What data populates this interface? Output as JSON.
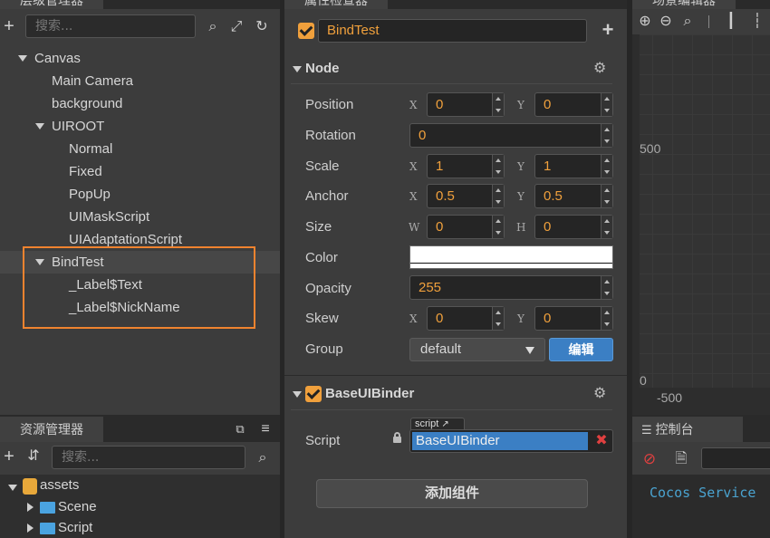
{
  "hierarchy": {
    "title": "层级管理器",
    "search_placeholder": "搜索...",
    "nodes": [
      {
        "label": "Canvas"
      },
      {
        "label": "Main Camera"
      },
      {
        "label": "background"
      },
      {
        "label": "UIROOT"
      },
      {
        "label": "Normal"
      },
      {
        "label": "Fixed"
      },
      {
        "label": "PopUp"
      },
      {
        "label": "UIMaskScript"
      },
      {
        "label": "UIAdaptationScript"
      },
      {
        "label": "BindTest"
      },
      {
        "label": "_Label$Text"
      },
      {
        "label": "_Label$NickName"
      }
    ],
    "highlight_color": "#f0832f"
  },
  "assets": {
    "title": "资源管理器",
    "search_placeholder": "搜索...",
    "items": [
      {
        "label": "assets"
      },
      {
        "label": "Scene"
      },
      {
        "label": "Script"
      }
    ]
  },
  "inspector": {
    "title": "属性检查器",
    "node_name": "BindTest",
    "node_section": "Node",
    "props": {
      "position": {
        "label": "Position",
        "x_axis": "X",
        "y_axis": "Y",
        "x": "0",
        "y": "0"
      },
      "rotation": {
        "label": "Rotation",
        "value": "0"
      },
      "scale": {
        "label": "Scale",
        "x_axis": "X",
        "y_axis": "Y",
        "x": "1",
        "y": "1"
      },
      "anchor": {
        "label": "Anchor",
        "x_axis": "X",
        "y_axis": "Y",
        "x": "0.5",
        "y": "0.5"
      },
      "size": {
        "label": "Size",
        "w_axis": "W",
        "h_axis": "H",
        "w": "0",
        "h": "0"
      },
      "color": {
        "label": "Color",
        "value": "#ffffff"
      },
      "opacity": {
        "label": "Opacity",
        "value": "255"
      },
      "skew": {
        "label": "Skew",
        "x_axis": "X",
        "y_axis": "Y",
        "x": "0",
        "y": "0"
      },
      "group": {
        "label": "Group",
        "value": "default",
        "edit_label": "编辑"
      }
    },
    "component": {
      "name": "BaseUIBinder",
      "script_label": "Script",
      "script_tag": "script",
      "script_value": "BaseUIBinder"
    },
    "add_component_label": "添加组件"
  },
  "scene": {
    "title": "场景编辑器",
    "ruler_labels": {
      "y500": "500",
      "y0": "0",
      "x_neg500": "-500"
    }
  },
  "console": {
    "title": "控制台",
    "line": "Cocos Service"
  },
  "colors": {
    "accent": "#f0a03c",
    "selection_blue": "#3b7fc4",
    "console_text": "#4aa3d0"
  }
}
